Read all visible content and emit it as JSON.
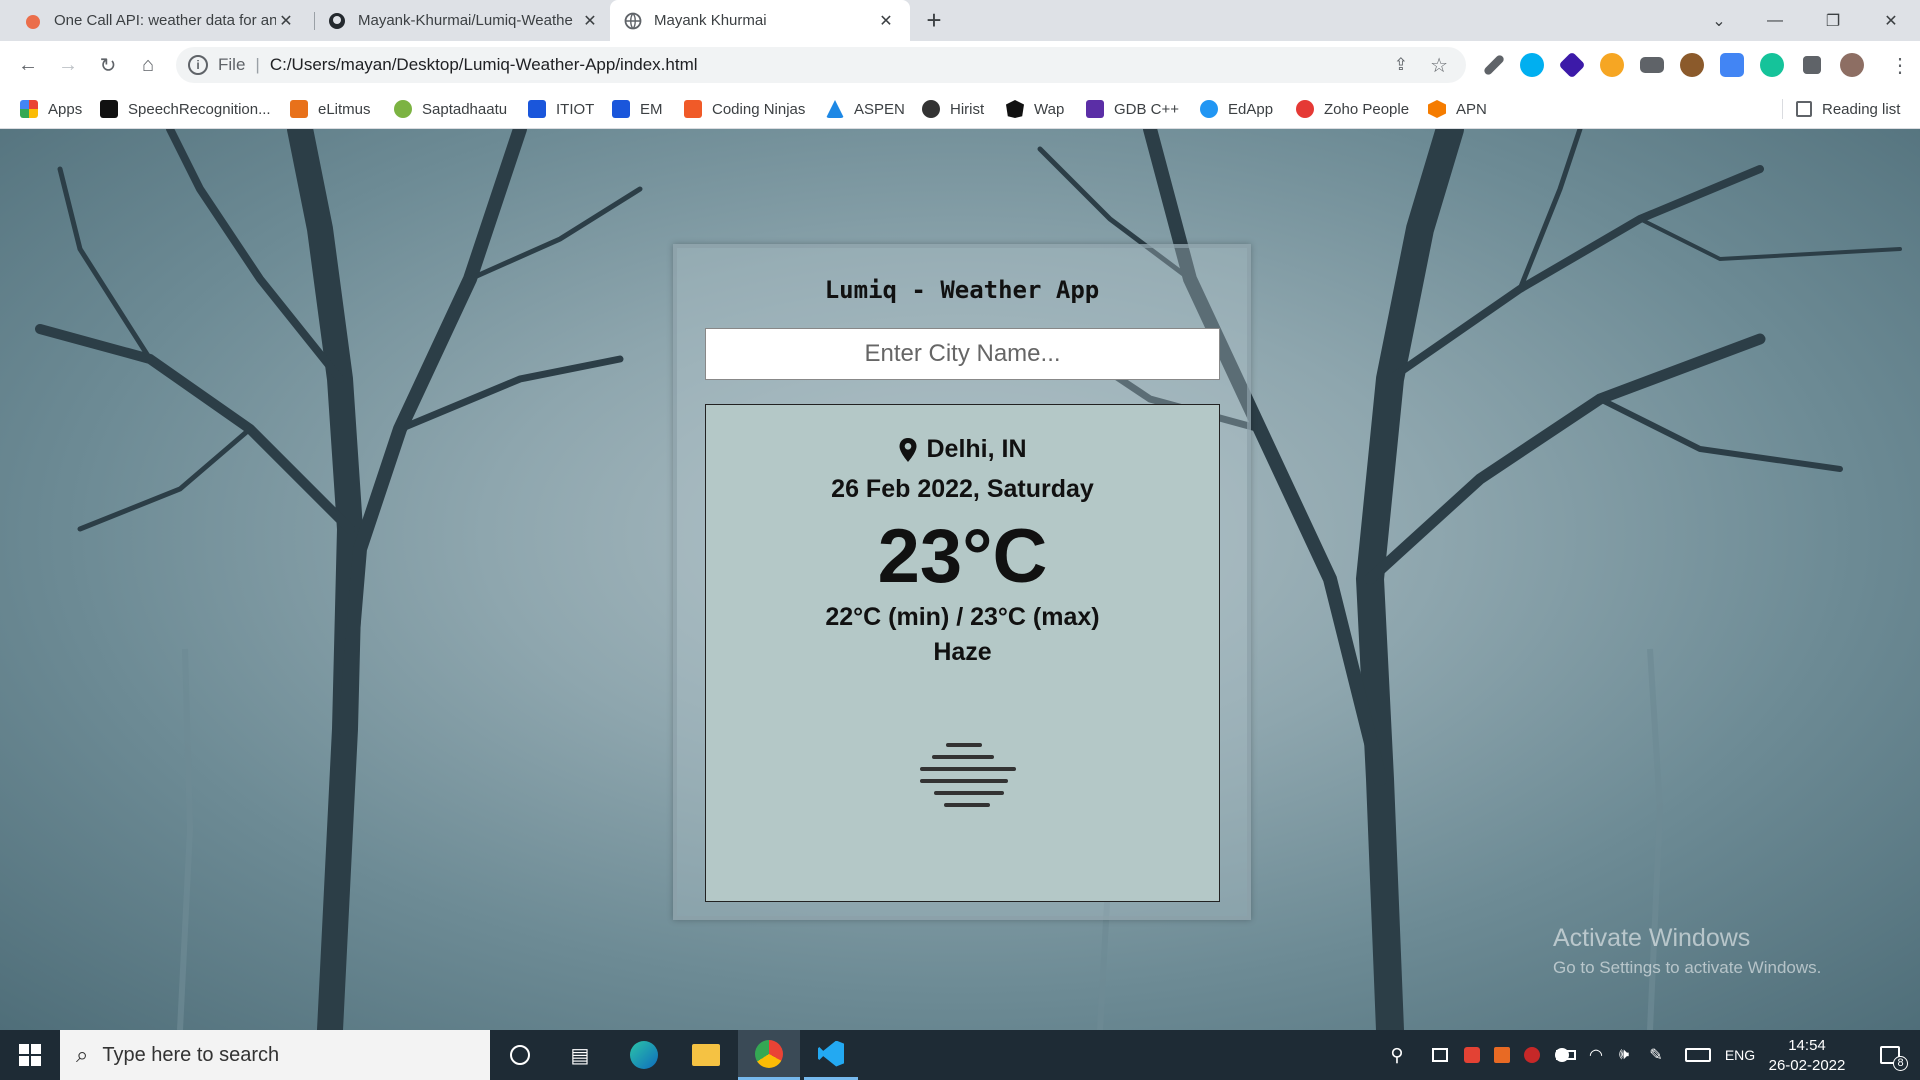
{
  "browser": {
    "tabs": [
      {
        "title": "One Call API: weather data for an",
        "icon": "openweather-icon"
      },
      {
        "title": "Mayank-Khurmai/Lumiq-Weathe",
        "icon": "github-icon"
      },
      {
        "title": "Mayank Khurmai",
        "icon": "globe-icon",
        "active": true
      }
    ],
    "new_tab": "+",
    "address": {
      "scheme_label": "File",
      "url": "C:/Users/mayan/Desktop/Lumiq-Weather-App/index.html"
    },
    "bookmarks": [
      {
        "label": "Apps",
        "color": "#ea4335"
      },
      {
        "label": "SpeechRecognition...",
        "color": "#111111"
      },
      {
        "label": "eLitmus",
        "color": "#e8711a"
      },
      {
        "label": "Saptadhaatu",
        "color": "#7cb342"
      },
      {
        "label": "ITIOT",
        "color": "#1a56db"
      },
      {
        "label": "EM",
        "color": "#1a56db"
      },
      {
        "label": "Coding Ninjas",
        "color": "#f05a28"
      },
      {
        "label": "ASPEN",
        "color": "#1e88e5"
      },
      {
        "label": "Hirist",
        "color": "#333333"
      },
      {
        "label": "Wap",
        "color": "#111111"
      },
      {
        "label": "GDB C++",
        "color": "#5b2ea6"
      },
      {
        "label": "EdApp",
        "color": "#2196f3"
      },
      {
        "label": "Zoho People",
        "color": "#e53935"
      },
      {
        "label": "APN",
        "color": "#f57c00"
      }
    ],
    "reading_list": "Reading list"
  },
  "app": {
    "title": "Lumiq - Weather App",
    "search_placeholder": "Enter City Name...",
    "location": "Delhi, IN",
    "date": "26 Feb 2022, Saturday",
    "temperature": "23°C",
    "min_max": "22°C (min) / 23°C (max)",
    "condition": "Haze",
    "condition_icon": "haze-icon"
  },
  "watermark": {
    "line1": "Activate Windows",
    "line2": "Go to Settings to activate Windows."
  },
  "taskbar": {
    "search_placeholder": "Type here to search",
    "language": "ENG",
    "time": "14:54",
    "date": "26-02-2022",
    "notifications": "8"
  }
}
